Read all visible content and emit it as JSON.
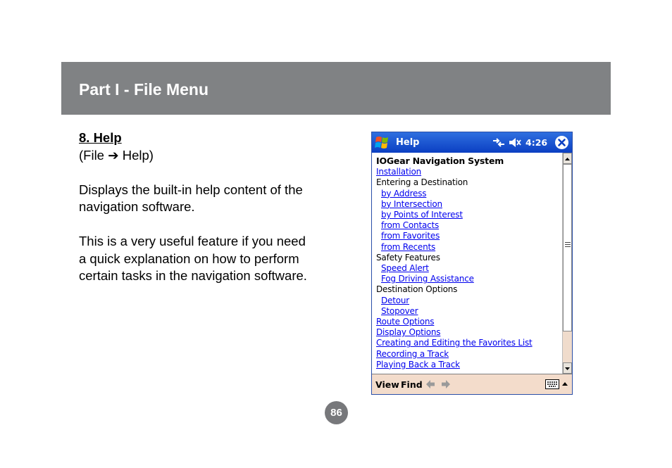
{
  "header": {
    "title": "Part I - File Menu"
  },
  "section": {
    "heading": "8. Help",
    "path": "(File ➔ Help)",
    "paragraph1_line1": "Displays the built-in help content of the",
    "paragraph1_line2": "navigation software.",
    "paragraph2_line1": "This is a very useful feature if you need",
    "paragraph2_line2": "a quick explanation on how to perform",
    "paragraph2_line3": "certain tasks in the navigation software."
  },
  "pda": {
    "title": "Help",
    "time": "4:26",
    "heading": "IOGear Navigation System",
    "entries": [
      {
        "text": "Installation",
        "type": "link",
        "indent": false
      },
      {
        "text": "Entering a Destination",
        "type": "label",
        "indent": false
      },
      {
        "text": "by Address",
        "type": "link",
        "indent": true
      },
      {
        "text": "by Intersection",
        "type": "link",
        "indent": true
      },
      {
        "text": "by Points of Interest",
        "type": "link",
        "indent": true
      },
      {
        "text": "from Contacts",
        "type": "link",
        "indent": true
      },
      {
        "text": "from Favorites",
        "type": "link",
        "indent": true
      },
      {
        "text": "from Recents",
        "type": "link",
        "indent": true
      },
      {
        "text": "Safety Features",
        "type": "label",
        "indent": false
      },
      {
        "text": "Speed Alert",
        "type": "link",
        "indent": true
      },
      {
        "text": "Fog Driving Assistance",
        "type": "link",
        "indent": true
      },
      {
        "text": "Destination Options",
        "type": "label",
        "indent": false
      },
      {
        "text": "Detour",
        "type": "link",
        "indent": true
      },
      {
        "text": "Stopover",
        "type": "link",
        "indent": true
      },
      {
        "text": "Route Options",
        "type": "link",
        "indent": false
      },
      {
        "text": "Display Options",
        "type": "link",
        "indent": false
      },
      {
        "text": "Creating and Editing the Favorites List",
        "type": "link",
        "indent": false
      },
      {
        "text": "Recording a Track",
        "type": "link",
        "indent": false
      },
      {
        "text": "Playing Back a Track",
        "type": "link",
        "indent": false
      }
    ],
    "menu": {
      "view": "View",
      "find": "Find"
    },
    "colors": {
      "title_bar": "#0b3fc2",
      "link": "#0000ee",
      "menu_bar": "#f3dccb"
    }
  },
  "page_number": "86"
}
